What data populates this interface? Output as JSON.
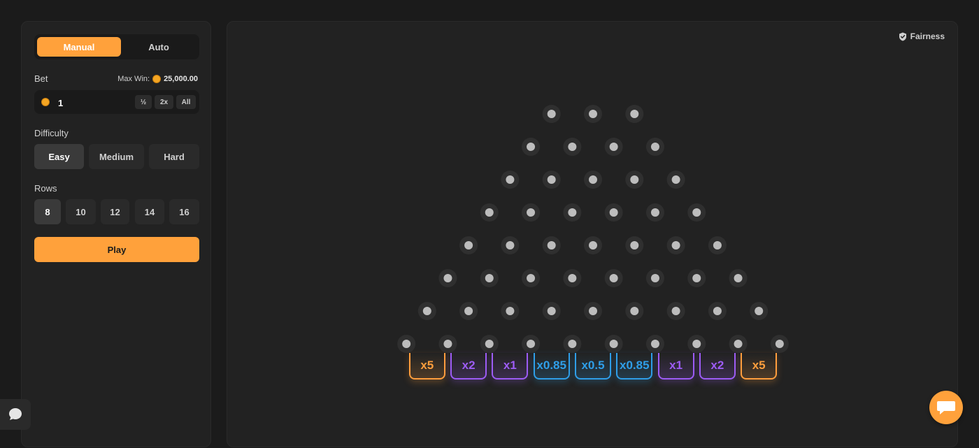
{
  "mode": {
    "manual_label": "Manual",
    "auto_label": "Auto",
    "selected": "Manual"
  },
  "bet": {
    "label": "Bet",
    "max_win_label": "Max Win:",
    "max_win_value": "25,000.00",
    "value": "1",
    "half_label": "½",
    "double_label": "2x",
    "all_label": "All"
  },
  "difficulty": {
    "label": "Difficulty",
    "options": [
      "Easy",
      "Medium",
      "Hard"
    ],
    "selected": "Easy"
  },
  "rows": {
    "label": "Rows",
    "options": [
      "8",
      "10",
      "12",
      "14",
      "16"
    ],
    "selected": "8"
  },
  "play_label": "Play",
  "fairness_label": "Fairness",
  "board": {
    "pin_rows": 8,
    "multipliers": [
      "x5",
      "x2",
      "x1",
      "x0.85",
      "x0.5",
      "x0.85",
      "x1",
      "x2",
      "x5"
    ],
    "multiplier_colors": [
      "#ff9e3d",
      "#9d5cf5",
      "#9d5cf5",
      "#2f9ee8",
      "#2f9ee8",
      "#2f9ee8",
      "#9d5cf5",
      "#9d5cf5",
      "#ff9e3d"
    ]
  },
  "colors": {
    "accent": "#ffa13b",
    "panel": "#222222",
    "background": "#1b1b1b"
  },
  "icons": {
    "fairness": "shield-check-icon",
    "chat_left": "chat-bubble-icon",
    "chat_right": "message-icon"
  }
}
